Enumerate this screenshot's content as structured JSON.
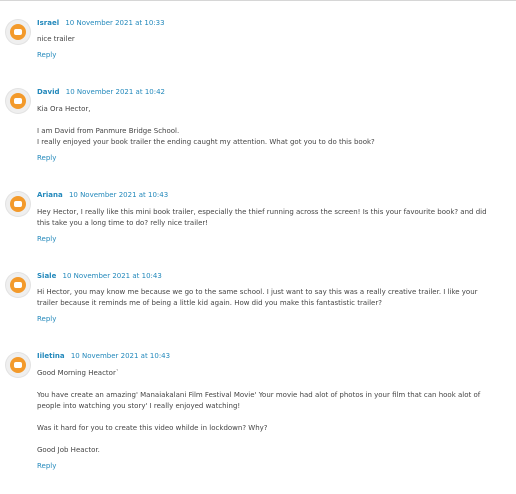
{
  "comments": [
    {
      "author": "Israel",
      "date": "10 November 2021 at 10:33",
      "lines": [
        "nice trailer"
      ],
      "reply": "Reply"
    },
    {
      "author": "David",
      "date": "10 November 2021 at 10:42",
      "lines": [
        "Kia Ora Hector,",
        "I am David from Panmure Bridge School.",
        "I really enjoyed your book trailer the ending caught my attention. What got you to do this book?"
      ],
      "reply": "Reply"
    },
    {
      "author": "Ariana",
      "date": "10 November 2021 at 10:43",
      "lines": [
        "Hey Hector, I really like this mini book trailer, especially the thief running across the screen! Is this your favourite book? and did this take you a long time to do? relly nice trailer!"
      ],
      "reply": "Reply"
    },
    {
      "author": "Siale",
      "date": "10 November 2021 at 10:43",
      "lines": [
        "Hi Hector, you may know me because we go to the same school. I just want to say this was a really creative trailer. I like your trailer because it reminds me of being a little kid again. How did you make this fantastistic trailer?"
      ],
      "reply": "Reply"
    },
    {
      "author": "Iiletina",
      "date": "10 November 2021 at 10:43",
      "lines": [
        "Good Morning Heactor`",
        "You have create an amazing' Manaiakalani Film Festival Movie' Your movie had alot of photos in your film that can hook alot of people into watching you story' I really enjoyed watching!",
        "Was it hard for you to create this video whilde in lockdown? Why?",
        "Good Job Heactor."
      ],
      "reply": "Reply"
    }
  ],
  "icon": "blogger-avatar-icon",
  "colors": {
    "link": "#2288bb",
    "text": "#444444",
    "avatar": "#f39a2b"
  }
}
